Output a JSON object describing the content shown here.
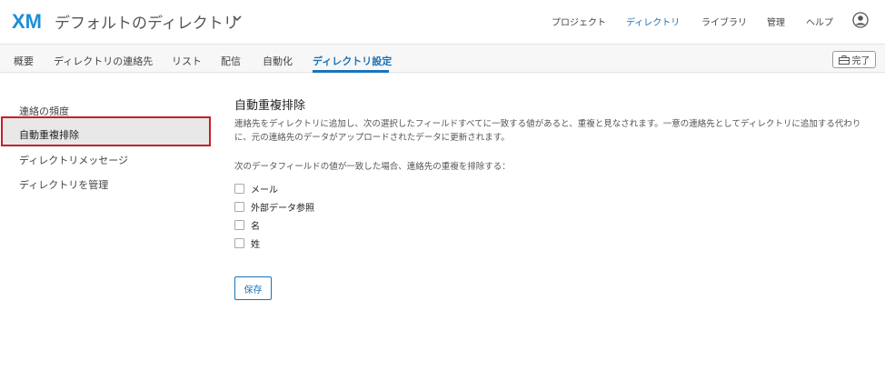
{
  "header": {
    "logo_text": "XM",
    "directory_title": "デフォルトのディレクトリ",
    "nav": [
      "プロジェクト",
      "ディレクトリ",
      "ライブラリ",
      "管理",
      "ヘルプ"
    ],
    "active_nav": "ディレクトリ"
  },
  "tabs": {
    "items": [
      "概要",
      "ディレクトリの連絡先",
      "リスト",
      "配信",
      "自動化",
      "ディレクトリ設定"
    ],
    "active": "ディレクトリ設定",
    "done_label": "完了"
  },
  "sidebar": {
    "items": [
      "連絡の頻度",
      "自動重複排除",
      "ディレクトリメッセージ",
      "ディレクトリを管理"
    ],
    "selected": "自動重複排除"
  },
  "main": {
    "title": "自動重複排除",
    "description": "連絡先をディレクトリに追加し、次の選択したフィールドすべてに一致する値があると、重複と見なされます。一意の連絡先としてディレクトリに追加する代わりに、元の連絡先のデータがアップロードされたデータに更新されます。",
    "fields_label": "次のデータフィールドの値が一致した場合、連絡先の重複を排除する：",
    "fields": [
      {
        "label": "メール",
        "checked": false
      },
      {
        "label": "外部データ参照",
        "checked": false
      },
      {
        "label": "名",
        "checked": false
      },
      {
        "label": "姓",
        "checked": false
      }
    ],
    "save_label": "保存"
  },
  "colors": {
    "accent": "#1a73b8",
    "highlight_border": "#c52027"
  }
}
